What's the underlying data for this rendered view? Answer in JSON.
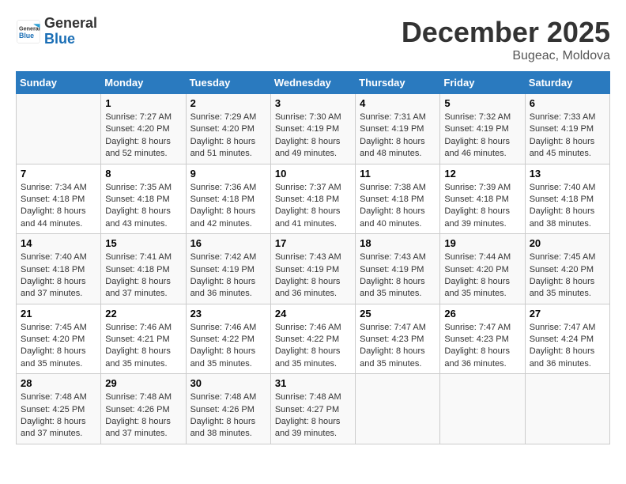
{
  "header": {
    "logo_line1": "General",
    "logo_line2": "Blue",
    "month": "December 2025",
    "location": "Bugeac, Moldova"
  },
  "weekdays": [
    "Sunday",
    "Monday",
    "Tuesday",
    "Wednesday",
    "Thursday",
    "Friday",
    "Saturday"
  ],
  "weeks": [
    [
      {
        "day": "",
        "content": ""
      },
      {
        "day": "1",
        "content": "Sunrise: 7:27 AM\nSunset: 4:20 PM\nDaylight: 8 hours\nand 52 minutes."
      },
      {
        "day": "2",
        "content": "Sunrise: 7:29 AM\nSunset: 4:20 PM\nDaylight: 8 hours\nand 51 minutes."
      },
      {
        "day": "3",
        "content": "Sunrise: 7:30 AM\nSunset: 4:19 PM\nDaylight: 8 hours\nand 49 minutes."
      },
      {
        "day": "4",
        "content": "Sunrise: 7:31 AM\nSunset: 4:19 PM\nDaylight: 8 hours\nand 48 minutes."
      },
      {
        "day": "5",
        "content": "Sunrise: 7:32 AM\nSunset: 4:19 PM\nDaylight: 8 hours\nand 46 minutes."
      },
      {
        "day": "6",
        "content": "Sunrise: 7:33 AM\nSunset: 4:19 PM\nDaylight: 8 hours\nand 45 minutes."
      }
    ],
    [
      {
        "day": "7",
        "content": "Sunrise: 7:34 AM\nSunset: 4:18 PM\nDaylight: 8 hours\nand 44 minutes."
      },
      {
        "day": "8",
        "content": "Sunrise: 7:35 AM\nSunset: 4:18 PM\nDaylight: 8 hours\nand 43 minutes."
      },
      {
        "day": "9",
        "content": "Sunrise: 7:36 AM\nSunset: 4:18 PM\nDaylight: 8 hours\nand 42 minutes."
      },
      {
        "day": "10",
        "content": "Sunrise: 7:37 AM\nSunset: 4:18 PM\nDaylight: 8 hours\nand 41 minutes."
      },
      {
        "day": "11",
        "content": "Sunrise: 7:38 AM\nSunset: 4:18 PM\nDaylight: 8 hours\nand 40 minutes."
      },
      {
        "day": "12",
        "content": "Sunrise: 7:39 AM\nSunset: 4:18 PM\nDaylight: 8 hours\nand 39 minutes."
      },
      {
        "day": "13",
        "content": "Sunrise: 7:40 AM\nSunset: 4:18 PM\nDaylight: 8 hours\nand 38 minutes."
      }
    ],
    [
      {
        "day": "14",
        "content": "Sunrise: 7:40 AM\nSunset: 4:18 PM\nDaylight: 8 hours\nand 37 minutes."
      },
      {
        "day": "15",
        "content": "Sunrise: 7:41 AM\nSunset: 4:18 PM\nDaylight: 8 hours\nand 37 minutes."
      },
      {
        "day": "16",
        "content": "Sunrise: 7:42 AM\nSunset: 4:19 PM\nDaylight: 8 hours\nand 36 minutes."
      },
      {
        "day": "17",
        "content": "Sunrise: 7:43 AM\nSunset: 4:19 PM\nDaylight: 8 hours\nand 36 minutes."
      },
      {
        "day": "18",
        "content": "Sunrise: 7:43 AM\nSunset: 4:19 PM\nDaylight: 8 hours\nand 35 minutes."
      },
      {
        "day": "19",
        "content": "Sunrise: 7:44 AM\nSunset: 4:20 PM\nDaylight: 8 hours\nand 35 minutes."
      },
      {
        "day": "20",
        "content": "Sunrise: 7:45 AM\nSunset: 4:20 PM\nDaylight: 8 hours\nand 35 minutes."
      }
    ],
    [
      {
        "day": "21",
        "content": "Sunrise: 7:45 AM\nSunset: 4:20 PM\nDaylight: 8 hours\nand 35 minutes."
      },
      {
        "day": "22",
        "content": "Sunrise: 7:46 AM\nSunset: 4:21 PM\nDaylight: 8 hours\nand 35 minutes."
      },
      {
        "day": "23",
        "content": "Sunrise: 7:46 AM\nSunset: 4:22 PM\nDaylight: 8 hours\nand 35 minutes."
      },
      {
        "day": "24",
        "content": "Sunrise: 7:46 AM\nSunset: 4:22 PM\nDaylight: 8 hours\nand 35 minutes."
      },
      {
        "day": "25",
        "content": "Sunrise: 7:47 AM\nSunset: 4:23 PM\nDaylight: 8 hours\nand 35 minutes."
      },
      {
        "day": "26",
        "content": "Sunrise: 7:47 AM\nSunset: 4:23 PM\nDaylight: 8 hours\nand 36 minutes."
      },
      {
        "day": "27",
        "content": "Sunrise: 7:47 AM\nSunset: 4:24 PM\nDaylight: 8 hours\nand 36 minutes."
      }
    ],
    [
      {
        "day": "28",
        "content": "Sunrise: 7:48 AM\nSunset: 4:25 PM\nDaylight: 8 hours\nand 37 minutes."
      },
      {
        "day": "29",
        "content": "Sunrise: 7:48 AM\nSunset: 4:26 PM\nDaylight: 8 hours\nand 37 minutes."
      },
      {
        "day": "30",
        "content": "Sunrise: 7:48 AM\nSunset: 4:26 PM\nDaylight: 8 hours\nand 38 minutes."
      },
      {
        "day": "31",
        "content": "Sunrise: 7:48 AM\nSunset: 4:27 PM\nDaylight: 8 hours\nand 39 minutes."
      },
      {
        "day": "",
        "content": ""
      },
      {
        "day": "",
        "content": ""
      },
      {
        "day": "",
        "content": ""
      }
    ]
  ]
}
